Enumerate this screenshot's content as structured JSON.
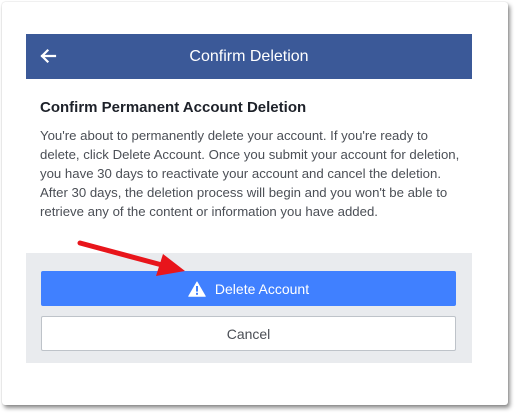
{
  "header": {
    "title": "Confirm Deletion",
    "back_icon": "arrow-left-icon"
  },
  "content": {
    "title": "Confirm Permanent Account Deletion",
    "body": "You're about to permanently delete your account. If you're ready to delete, click Delete Account. Once you submit your account for deletion, you have 30 days to reactivate your account and cancel the deletion. After 30 days, the deletion process will begin and you won't be able to retrieve any of the content or information you have added."
  },
  "actions": {
    "delete_label": "Delete Account",
    "delete_icon": "warning-triangle-icon",
    "cancel_label": "Cancel"
  },
  "colors": {
    "header_bg": "#3b5998",
    "primary_button": "#4080ff",
    "footer_bg": "#e9ebee",
    "annotation_arrow": "#e8151b"
  }
}
